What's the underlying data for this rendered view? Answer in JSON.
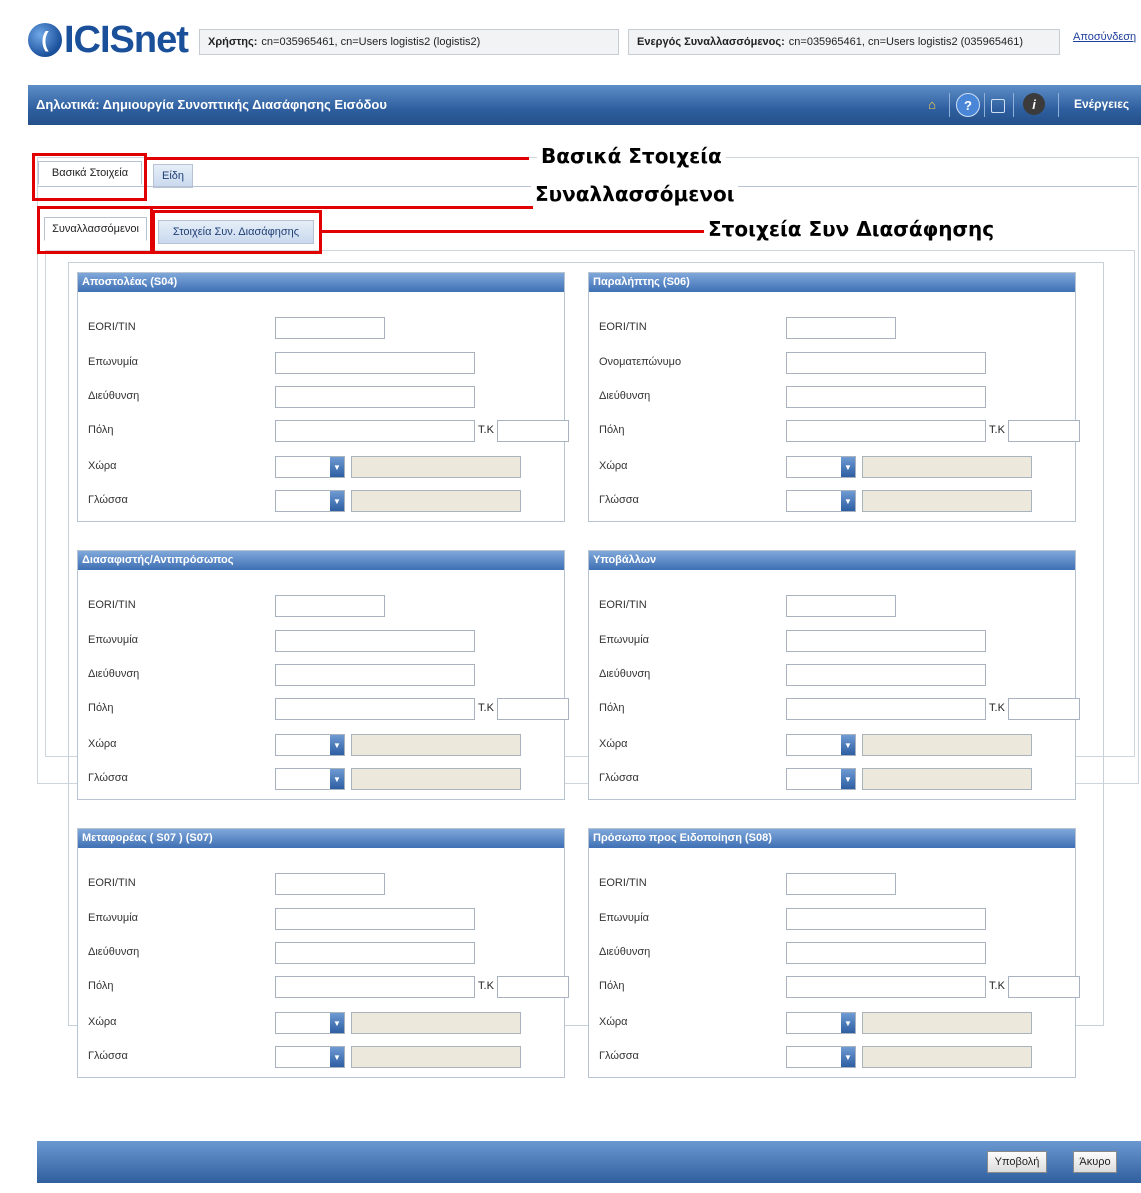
{
  "header": {
    "logo_text": "ICISnet",
    "user_label": "Χρήστης:",
    "user_value": "cn=035965461, cn=Users logistis2 (logistis2)",
    "active_label": "Ενεργός Συναλλασσόμενος:",
    "active_value": "cn=035965461, cn=Users logistis2 (035965461)",
    "logout": "Αποσύνδεση"
  },
  "titlebar": {
    "title": "Δηλωτικά: Δημιουργία Συνοπτικής Διασάφησης Εισόδου",
    "icons": [
      "home-icon",
      "help-icon",
      "window-icon",
      "info-icon"
    ],
    "actions": "Ενέργειες"
  },
  "tabs": {
    "main": [
      "Βασικά Στοιχεία",
      "Είδη"
    ],
    "sub": [
      "Συναλλασσόμενοι",
      "Στοιχεία Συν. Διασάφησης"
    ]
  },
  "annotations": {
    "basic": "Βασικά Στοιχεία",
    "traders": "Συναλλασσόμενοι",
    "declaration": "Στοιχεία Συν Διασάφησης"
  },
  "sections": [
    {
      "title": "Αποστολέας (S04)",
      "labels": [
        "EORI/TIN",
        "Επωνυμία",
        "Διεύθυνση",
        "Πόλη",
        "Χώρα",
        "Γλώσσα"
      ]
    },
    {
      "title": "Παραλήπτης (S06)",
      "labels": [
        "EORI/TIN",
        "Ονοματεπώνυμο",
        "Διεύθυνση",
        "Πόλη",
        "Χώρα",
        "Γλώσσα"
      ]
    },
    {
      "title": "Διασαφιστής/Αντιπρόσωπος",
      "labels": [
        "EORI/TIN",
        "Επωνυμία",
        "Διεύθυνση",
        "Πόλη",
        "Χώρα",
        "Γλώσσα"
      ]
    },
    {
      "title": "Υποβάλλων",
      "labels": [
        "EORI/TIN",
        "Επωνυμία",
        "Διεύθυνση",
        "Πόλη",
        "Χώρα",
        "Γλώσσα"
      ]
    },
    {
      "title": "Μεταφορέας ( S07 ) (S07)",
      "labels": [
        "EORI/TIN",
        "Επωνυμία",
        "Διεύθυνση",
        "Πόλη",
        "Χώρα",
        "Γλώσσα"
      ]
    },
    {
      "title": "Πρόσωπο προς Ειδοποίηση (S08)",
      "labels": [
        "EORI/TIN",
        "Επωνυμία",
        "Διεύθυνση",
        "Πόλη",
        "Χώρα",
        "Γλώσσα"
      ]
    }
  ],
  "postal_label": "Τ.Κ",
  "footer": {
    "submit": "Υποβολή",
    "cancel": "Άκυρο"
  },
  "colors": {
    "brand": "#1a4f9a",
    "annotation": "#e00000"
  }
}
